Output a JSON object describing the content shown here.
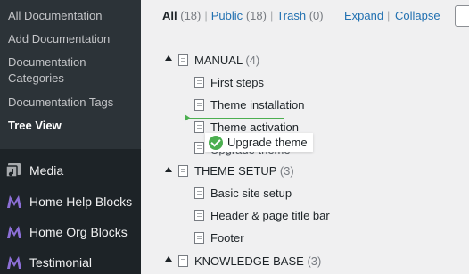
{
  "sidebar": {
    "submenu": [
      {
        "label": "All Documentation"
      },
      {
        "label": "Add Documentation"
      },
      {
        "label": "Documentation Categories"
      },
      {
        "label": "Documentation Tags"
      },
      {
        "label": "Tree View"
      }
    ],
    "menu": [
      {
        "label": "Media",
        "icon": "media-icon"
      },
      {
        "label": "Home Help Blocks",
        "icon": "m-logo-icon"
      },
      {
        "label": "Home Org Blocks",
        "icon": "m-logo-icon"
      },
      {
        "label": "Testimonial",
        "icon": "m-logo-icon"
      }
    ]
  },
  "filters": {
    "all": {
      "label": "All",
      "count": "(18)"
    },
    "public": {
      "label": "Public",
      "count": "(18)"
    },
    "trash": {
      "label": "Trash",
      "count": "(0)"
    },
    "separator": "|"
  },
  "actions": {
    "expand": "Expand",
    "collapse": "Collapse",
    "separator": "|"
  },
  "tree": {
    "manual": {
      "title": "MANUAL",
      "count": "(4)"
    },
    "manual_children": [
      "First steps",
      "Theme installation",
      "Theme activation",
      "Upgrade theme"
    ],
    "theme_setup": {
      "title": "THEME SETUP",
      "count": "(3)"
    },
    "theme_setup_children": [
      "Basic site setup",
      "Header & page title bar",
      "Footer"
    ],
    "knowledge_base": {
      "title": "KNOWLEDGE BASE",
      "count": "(3)"
    }
  },
  "drag_helper": {
    "label": "Upgrade theme"
  },
  "colors": {
    "accent": "#2271b1",
    "sidebar": "#1d2327",
    "submenu": "#2c3338",
    "drop_indicator": "#4caf50",
    "brand_m": "#8c6fd6"
  }
}
